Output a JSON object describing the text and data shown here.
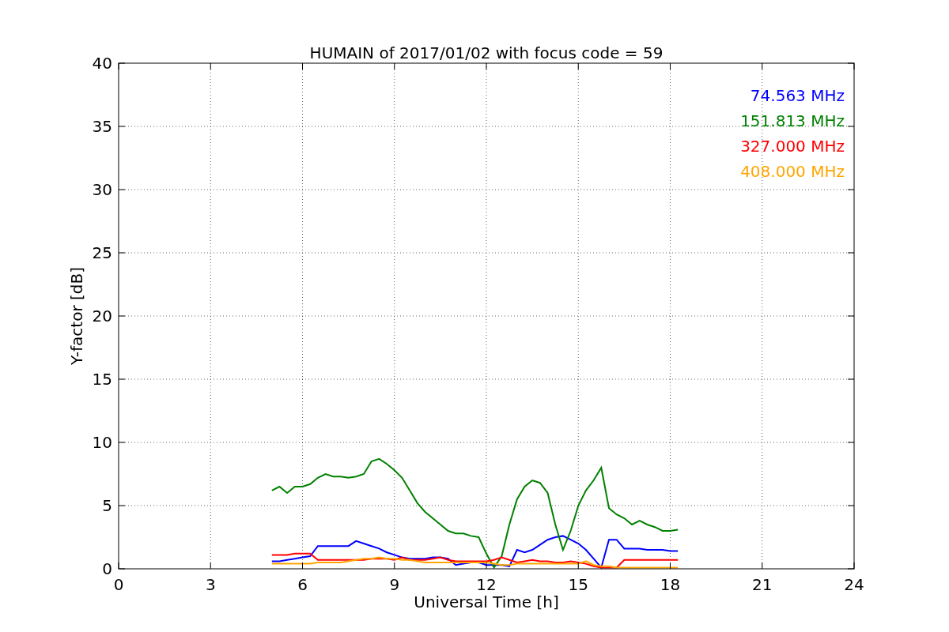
{
  "chart_data": {
    "type": "line",
    "title": "HUMAIN of 2017/01/02 with focus code = 59",
    "xlabel": "Universal Time [h]",
    "ylabel": "Y-factor [dB]",
    "x": [
      5,
      5.25,
      5.5,
      5.75,
      6,
      6.25,
      6.5,
      6.75,
      7,
      7.25,
      7.5,
      7.75,
      8,
      8.25,
      8.5,
      8.75,
      9,
      9.25,
      9.5,
      9.75,
      10,
      10.25,
      10.5,
      10.75,
      11,
      11.25,
      11.5,
      11.75,
      12,
      12.25,
      12.5,
      12.75,
      13,
      13.25,
      13.5,
      13.75,
      14,
      14.25,
      14.5,
      14.75,
      15,
      15.25,
      15.5,
      15.75,
      16,
      16.25,
      16.5,
      16.75,
      17,
      17.25,
      17.5,
      17.75,
      18,
      18.25
    ],
    "series": [
      {
        "name": "74.563 MHz",
        "color": "#0000ff",
        "values": [
          0.6,
          0.6,
          0.7,
          0.8,
          0.9,
          1.0,
          1.8,
          1.8,
          1.8,
          1.8,
          1.8,
          2.2,
          2.0,
          1.8,
          1.6,
          1.3,
          1.1,
          0.9,
          0.8,
          0.8,
          0.8,
          0.9,
          0.9,
          0.8,
          0.3,
          0.4,
          0.5,
          0.5,
          0.3,
          0.3,
          0.3,
          0.2,
          1.5,
          1.3,
          1.5,
          1.9,
          2.3,
          2.5,
          2.6,
          2.3,
          2.0,
          1.5,
          0.8,
          0.1,
          2.3,
          2.3,
          1.6,
          1.6,
          1.6,
          1.5,
          1.5,
          1.5,
          1.4,
          1.4
        ]
      },
      {
        "name": "151.813 MHz",
        "color": "#008000",
        "values": [
          6.2,
          6.5,
          6.0,
          6.5,
          6.5,
          6.7,
          7.2,
          7.5,
          7.3,
          7.3,
          7.2,
          7.3,
          7.5,
          8.5,
          8.7,
          8.3,
          7.8,
          7.2,
          6.2,
          5.2,
          4.5,
          4.0,
          3.5,
          3.0,
          2.8,
          2.8,
          2.6,
          2.5,
          1.2,
          0.1,
          1.0,
          3.5,
          5.5,
          6.5,
          7.0,
          6.8,
          6.0,
          3.5,
          1.5,
          3.0,
          5.0,
          6.2,
          7.0,
          8.0,
          4.8,
          4.3,
          4.0,
          3.5,
          3.8,
          3.5,
          3.3,
          3.0,
          3.0,
          3.1
        ]
      },
      {
        "name": "327.000 MHz",
        "color": "#ff0000",
        "values": [
          1.1,
          1.1,
          1.1,
          1.2,
          1.2,
          1.2,
          0.7,
          0.7,
          0.7,
          0.7,
          0.7,
          0.7,
          0.7,
          0.8,
          0.8,
          0.8,
          0.7,
          0.9,
          0.7,
          0.7,
          0.7,
          0.8,
          0.9,
          0.7,
          0.6,
          0.6,
          0.6,
          0.6,
          0.6,
          0.7,
          0.9,
          0.7,
          0.5,
          0.6,
          0.7,
          0.6,
          0.6,
          0.5,
          0.5,
          0.6,
          0.5,
          0.4,
          0.2,
          0.1,
          0.1,
          0.1,
          0.7,
          0.7,
          0.7,
          0.7,
          0.7,
          0.7,
          0.7,
          0.7
        ]
      },
      {
        "name": "408.000 MHz",
        "color": "#ffa500",
        "values": [
          0.4,
          0.4,
          0.4,
          0.4,
          0.4,
          0.4,
          0.5,
          0.5,
          0.5,
          0.5,
          0.6,
          0.7,
          0.8,
          0.8,
          0.9,
          0.8,
          0.8,
          0.7,
          0.7,
          0.6,
          0.5,
          0.5,
          0.5,
          0.5,
          0.5,
          0.5,
          0.5,
          0.5,
          0.5,
          0.4,
          0.3,
          0.3,
          0.4,
          0.4,
          0.4,
          0.4,
          0.4,
          0.4,
          0.4,
          0.4,
          0.4,
          0.6,
          0.3,
          0.2,
          0.2,
          0.1,
          0.1,
          0.1,
          0.1,
          0.1,
          0.1,
          0.1,
          0.1,
          0.1
        ]
      }
    ],
    "grid": true,
    "xlim": [
      0,
      24
    ],
    "ylim": [
      0,
      40
    ],
    "xticks": [
      0,
      3,
      6,
      9,
      12,
      15,
      18,
      21,
      24
    ],
    "yticks": [
      0,
      5,
      10,
      15,
      20,
      25,
      30,
      35,
      40
    ]
  }
}
